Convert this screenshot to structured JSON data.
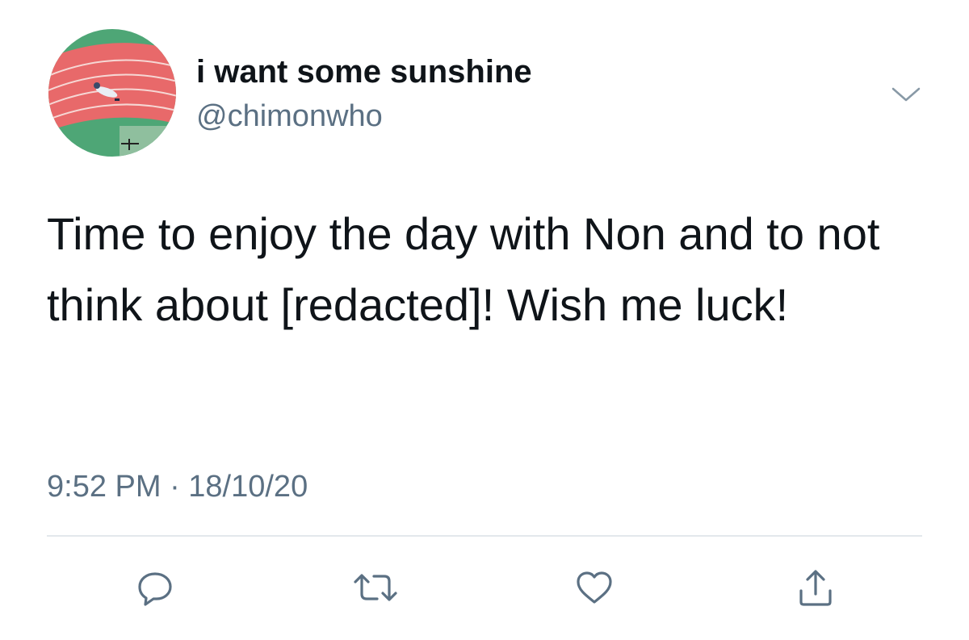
{
  "tweet": {
    "display_name": "i want some sunshine",
    "handle": "@chimonwho",
    "text": "Time to enjoy the day with Non and to not think about [redacted]! Wish me luck!",
    "timestamp": "9:52 PM · 18/10/20"
  },
  "actions": [
    {
      "name": "reply",
      "icon": "reply-icon"
    },
    {
      "name": "retweet",
      "icon": "retweet-icon"
    },
    {
      "name": "like",
      "icon": "heart-icon"
    },
    {
      "name": "share",
      "icon": "share-icon"
    }
  ],
  "colors": {
    "text_primary": "#0f1419",
    "text_secondary": "#5b7083",
    "divider": "#e3e8ec",
    "avatar_track": "#e8696a",
    "avatar_field": "#55a97a"
  }
}
